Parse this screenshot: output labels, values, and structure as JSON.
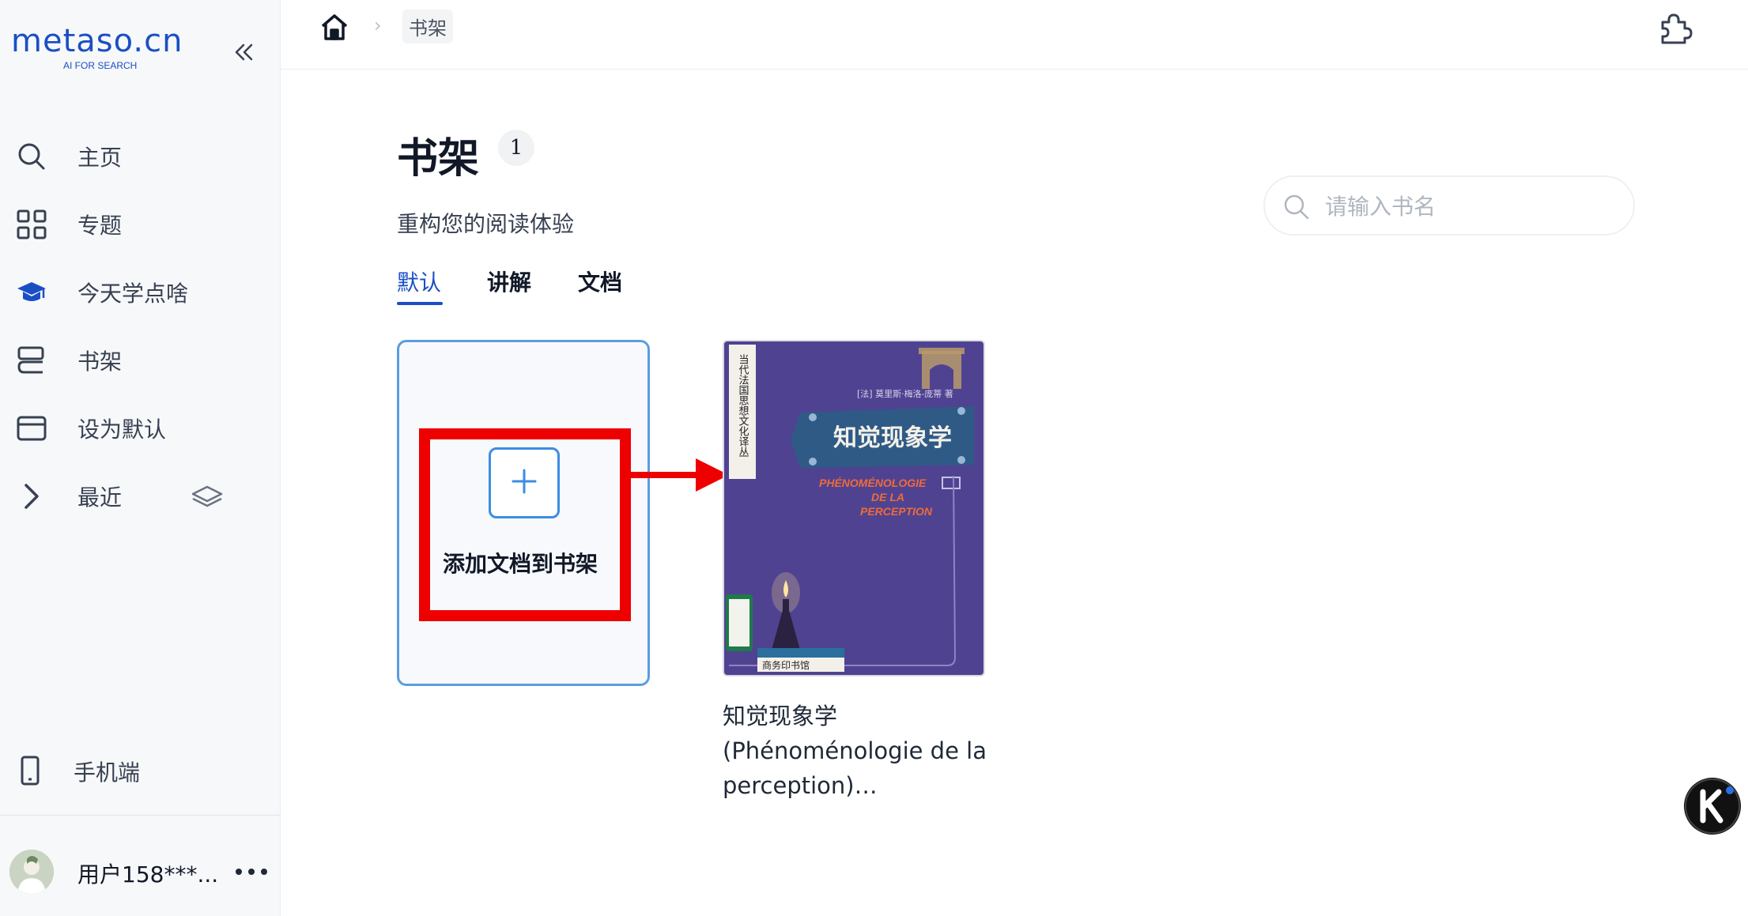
{
  "sidebar": {
    "logo": "metaso.cn",
    "logo_tagline": "AI FOR SEARCH",
    "items": [
      {
        "label": "主页",
        "icon": "search-icon"
      },
      {
        "label": "专题",
        "icon": "grid-icon"
      },
      {
        "label": "今天学点啥",
        "icon": "graduation-cap-icon"
      },
      {
        "label": "书架",
        "icon": "bookshelf-icon"
      },
      {
        "label": "设为默认",
        "icon": "window-icon"
      },
      {
        "label": "最近",
        "icon": "chevron-right-icon"
      }
    ],
    "mobile_label": "手机端",
    "user_name": "用户158***..."
  },
  "header": {
    "breadcrumb_current": "书架"
  },
  "main": {
    "title": "书架",
    "count": "1",
    "subtitle": "重构您的阅读体验",
    "search_placeholder": "请输入书名",
    "tabs": [
      {
        "label": "默认",
        "active": true
      },
      {
        "label": "讲解",
        "active": false
      },
      {
        "label": "文档",
        "active": false
      }
    ],
    "add_card_label": "添加文档到书架",
    "books": [
      {
        "title": "知觉现象学 (Phénoménologie de la perception)…",
        "cover_series": "当代法国思想文化译丛",
        "cover_author": "[法] 莫里斯·梅洛-庞蒂 著",
        "cover_title_cn": "知觉现象学",
        "cover_title_fr_1": "PHÉNOMÉNOLOGIE",
        "cover_title_fr_2": "DE LA",
        "cover_title_fr_3": "PERCEPTION",
        "cover_publisher": "商务印书馆"
      }
    ]
  },
  "colors": {
    "brand": "#1a4fc4",
    "annotation_red": "#ef0000",
    "cover_purple": "#4a3f8c"
  }
}
